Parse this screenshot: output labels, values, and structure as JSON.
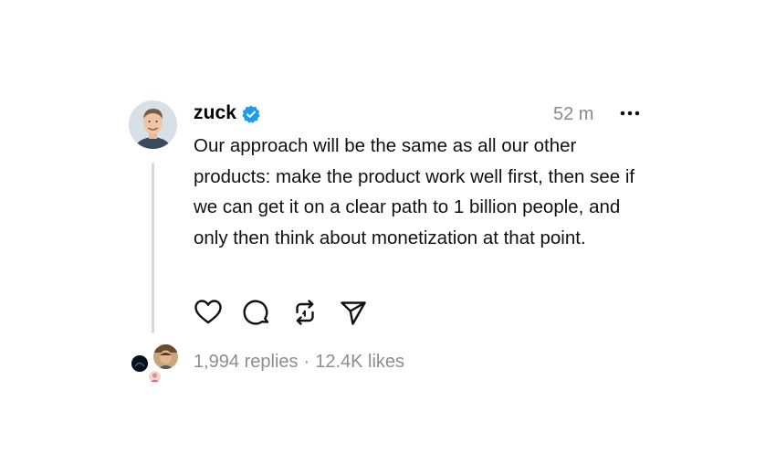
{
  "post": {
    "username": "zuck",
    "timestamp": "52 m",
    "text": "Our approach will be the same as all our other products: make the product work well first, then see if we can get it on a clear path to 1 billion people, and only then think about monetization at that point.",
    "stats": {
      "replies": "1,994 replies",
      "separator": "·",
      "likes": "12.4K likes"
    }
  },
  "icons": {
    "verified": "verified-badge-icon",
    "more": "more-options-icon",
    "like": "heart-icon",
    "reply": "comment-icon",
    "repost": "repost-icon",
    "share": "send-icon"
  },
  "colors": {
    "verified": "#1d9bf0",
    "muted": "#8e8e8e",
    "thread_line": "#d9d9d9",
    "text": "#111111"
  }
}
